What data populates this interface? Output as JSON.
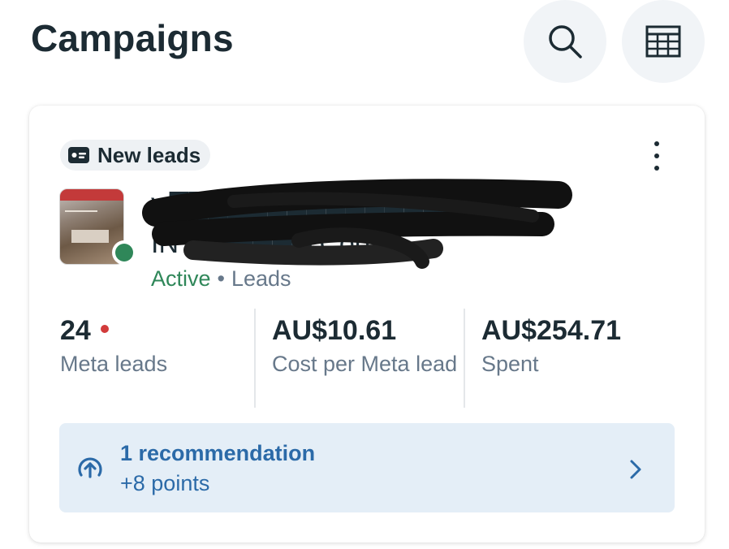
{
  "header": {
    "title": "Campaigns",
    "search_icon": "search-icon",
    "table_icon": "table-view-icon"
  },
  "campaign": {
    "badge": {
      "icon": "lead-card-icon",
      "label": "New leads"
    },
    "more_icon": "more-vertical-icon",
    "name_line1": "V████████████████D/",
    "name_line2": "INTE█████ Copy",
    "status": "Active",
    "separator": "•",
    "objective": "Leads",
    "status_color": "#2f8759",
    "metrics": [
      {
        "value": "24",
        "label": "Meta leads",
        "alert": true
      },
      {
        "value": "AU$10.61",
        "label": "Cost per Meta lead"
      },
      {
        "value": "AU$254.71",
        "label": "Spent"
      }
    ],
    "recommendation": {
      "icon": "arrow-up-circle-icon",
      "title": "1 recommendation",
      "subtitle": "+8 points",
      "chevron": "chevron-right-icon",
      "accent_color": "#2b6aa8",
      "background": "#e4eef7"
    }
  }
}
